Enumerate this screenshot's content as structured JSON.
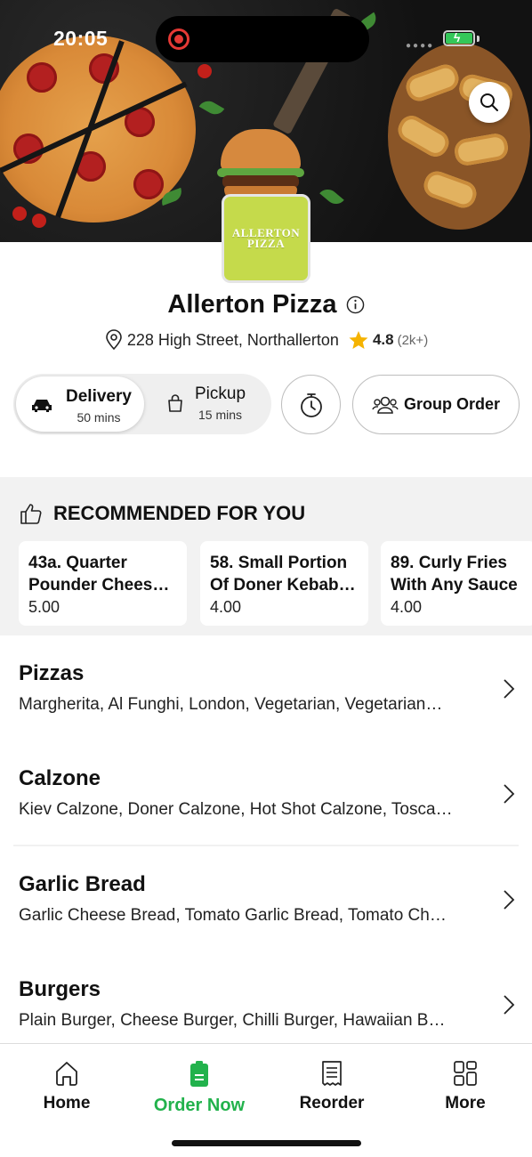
{
  "status_bar": {
    "time": "20:05"
  },
  "store": {
    "name": "Allerton Pizza",
    "logo_line1": "ALLERTON",
    "logo_line2": "PIZZA",
    "address": "228 High Street, Northallerton",
    "rating": "4.8",
    "rating_count": "(2k+)"
  },
  "mode": {
    "delivery_label": "Delivery",
    "delivery_time": "50 mins",
    "pickup_label": "Pickup",
    "pickup_time": "15 mins",
    "selected": "Delivery"
  },
  "group_order_label": "Group Order",
  "recommended": {
    "title": "RECOMMENDED FOR YOU",
    "items": [
      {
        "name": "43a. Quarter Pounder Chees…",
        "price": "5.00"
      },
      {
        "name": "58. Small Portion Of Doner Kebab…",
        "price": "4.00"
      },
      {
        "name": "89. Curly Fries With Any Sauce",
        "price": "4.00"
      }
    ]
  },
  "categories": [
    {
      "title": "Pizzas",
      "desc": "Margherita, Al Funghi, London, Vegetarian, Vegetarian…"
    },
    {
      "title": "Calzone",
      "desc": "Kiev Calzone, Doner Calzone, Hot Shot Calzone, Tosca…"
    },
    {
      "title": "Garlic Bread",
      "desc": "Garlic Cheese Bread, Tomato Garlic Bread, Tomato Ch…"
    },
    {
      "title": "Burgers",
      "desc": "Plain Burger, Cheese Burger, Chilli Burger, Hawaiian B…"
    }
  ],
  "bottom_nav": {
    "home": "Home",
    "order_now": "Order Now",
    "reorder": "Reorder",
    "more": "More",
    "active": "Order Now"
  },
  "colors": {
    "accent_green": "#22b24c",
    "logo_green": "#c5da4b",
    "star": "#f5b301"
  },
  "icons": [
    "search-icon",
    "info-icon",
    "location-pin-icon",
    "star-icon",
    "car-icon",
    "shopping-bag-icon",
    "timer-icon",
    "group-icon",
    "thumbs-up-icon",
    "chevron-right-icon",
    "home-icon",
    "order-icon",
    "receipt-icon",
    "grid-icon"
  ]
}
